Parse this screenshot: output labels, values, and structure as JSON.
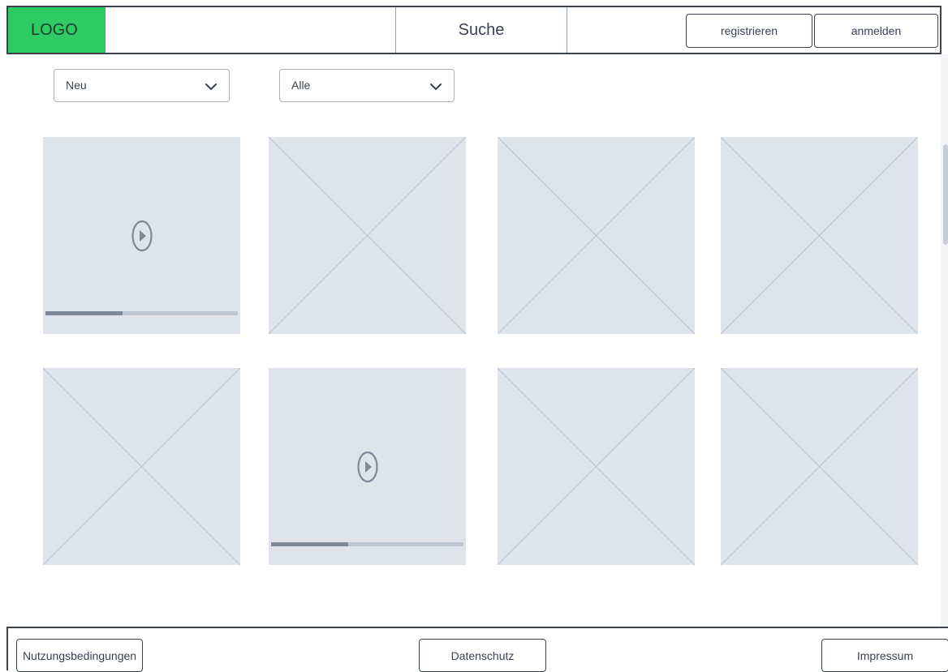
{
  "header": {
    "logo": "LOGO",
    "search_label": "Suche",
    "register_label": "registrieren",
    "login_label": "anmelden"
  },
  "filters": {
    "sort": {
      "selected": "Neu"
    },
    "category": {
      "selected": "Alle"
    }
  },
  "grid": {
    "tiles": [
      {
        "type": "video",
        "progress": 0.4
      },
      {
        "type": "image"
      },
      {
        "type": "image"
      },
      {
        "type": "image"
      },
      {
        "type": "image"
      },
      {
        "type": "video",
        "progress": 0.4
      },
      {
        "type": "image"
      },
      {
        "type": "image"
      }
    ]
  },
  "footer": {
    "terms_label": "Nutzungsbedingungen",
    "privacy_label": "Datenschutz",
    "imprint_label": "Impressum"
  },
  "colors": {
    "logo_bg": "#2ecb63",
    "placeholder_bg": "#dfe4ec",
    "placeholder_line": "#b8c2ce",
    "border": "#3c4250",
    "progress_fill": "#7d8999",
    "progress_track": "#bdc7d3"
  },
  "icons": {
    "dropdown": "chevron-down-icon",
    "video": "play-icon",
    "image_placeholder": "image-placeholder-icon"
  }
}
